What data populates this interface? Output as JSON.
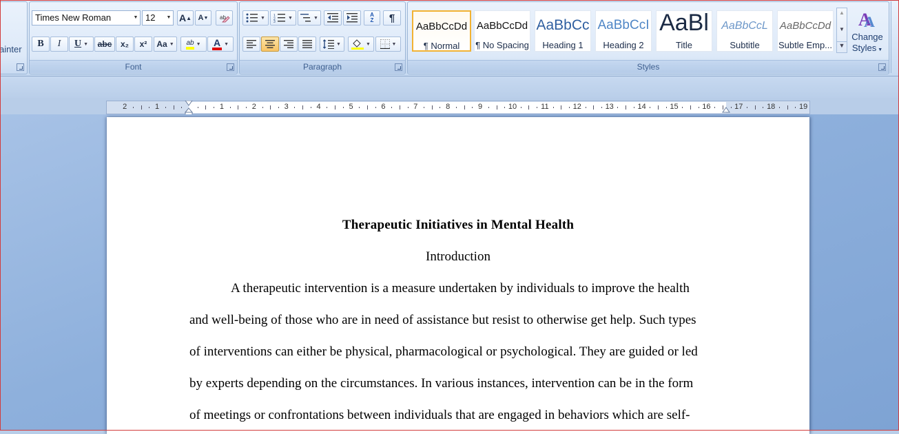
{
  "clipboard": {
    "partial_label": "ainter"
  },
  "font_group": {
    "font_name": "Times New Roman",
    "font_size": "12",
    "grow_label": "A",
    "shrink_label": "A",
    "bold": "B",
    "italic": "I",
    "underline": "U",
    "strikethrough": "abc",
    "subscript": "x₂",
    "superscript": "x²",
    "change_case": "Aa",
    "highlight_label": "ab",
    "font_color_label": "A",
    "label": "Font"
  },
  "paragraph_group": {
    "sort_label": "A Z",
    "label": "Paragraph"
  },
  "styles_group": {
    "items": [
      {
        "sample": "AaBbCcDd",
        "name": "¶ Normal"
      },
      {
        "sample": "AaBbCcDd",
        "name": "¶ No Spacing"
      },
      {
        "sample": "AaBbCc",
        "name": "Heading 1"
      },
      {
        "sample": "AaBbCcI",
        "name": "Heading 2"
      },
      {
        "sample": "AaBl",
        "name": "Title"
      },
      {
        "sample": "AaBbCcL",
        "name": "Subtitle"
      },
      {
        "sample": "AaBbCcDd",
        "name": "Subtle Emp..."
      }
    ],
    "change_styles_line1": "Change",
    "change_styles_line2": "Styles",
    "label": "Styles"
  },
  "ruler": {
    "numbers": [
      "2",
      "1",
      "1",
      "2",
      "3",
      "4",
      "5",
      "6",
      "7",
      "8",
      "9",
      "10",
      "11",
      "12",
      "13",
      "14",
      "15",
      "16",
      "17",
      "18",
      "19"
    ]
  },
  "document": {
    "title": "Therapeutic Initiatives in Mental Health",
    "heading": "Introduction",
    "lines": [
      "A therapeutic intervention is a measure undertaken by individuals to improve the health",
      "and well-being of those who are in need of assistance but resist to otherwise get help. Such types",
      "of interventions can either be physical, pharmacological or psychological. They are guided or led",
      "by experts depending on the circumstances. In various instances, intervention can be in the form",
      "of meetings or confrontations between individuals that are engaged in behaviors which are self-"
    ]
  },
  "colors": {
    "highlight": "#ffff00",
    "font_color": "#e00000",
    "accent": "#f2b233"
  }
}
